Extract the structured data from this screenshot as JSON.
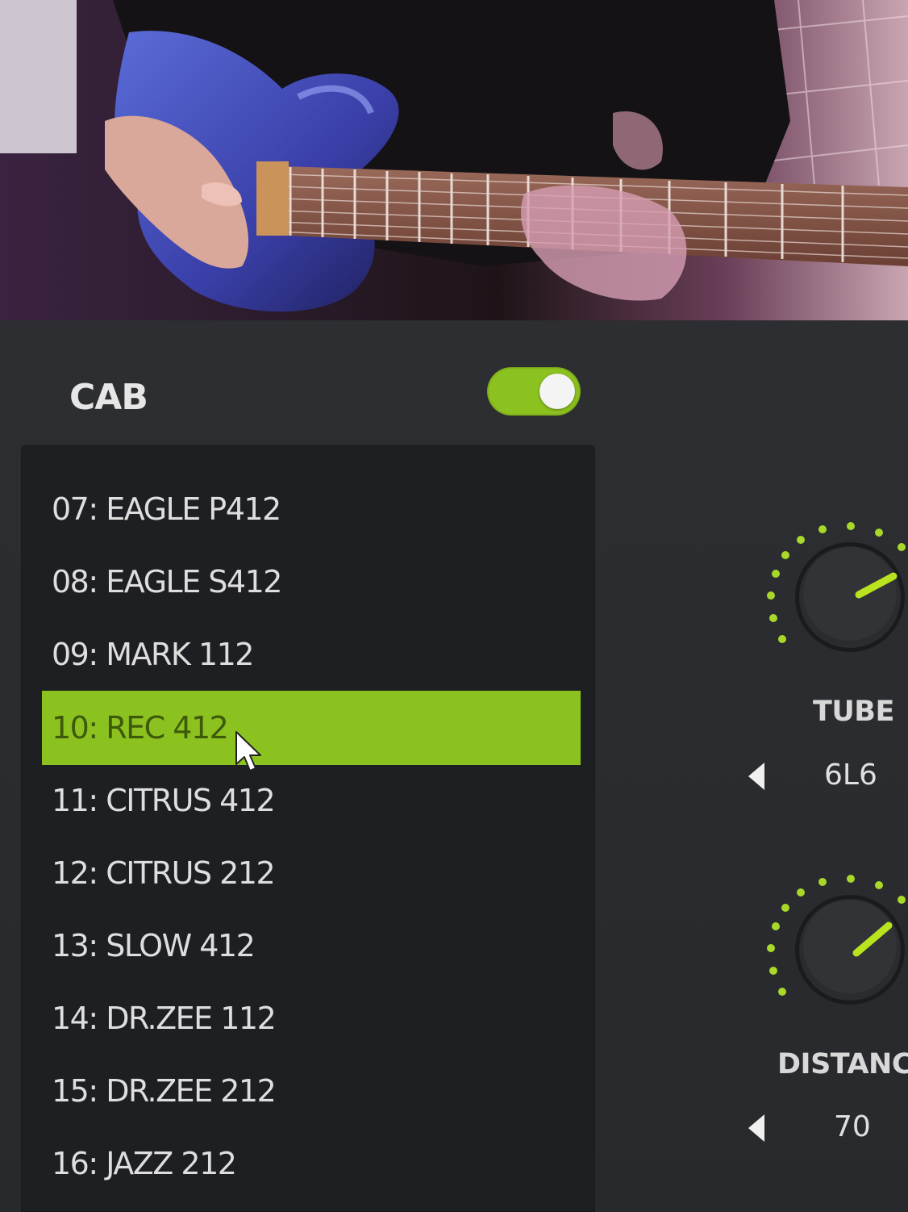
{
  "cab": {
    "title": "CAB",
    "enabled": true,
    "accent_color": "#8cc21f",
    "items": [
      {
        "label": "07: EAGLE P412",
        "selected": false
      },
      {
        "label": "08: EAGLE S412",
        "selected": false
      },
      {
        "label": "09: MARK 112",
        "selected": false
      },
      {
        "label": "10: REC 412",
        "selected": true
      },
      {
        "label": "11: CITRUS 412",
        "selected": false
      },
      {
        "label": "12: CITRUS 212",
        "selected": false
      },
      {
        "label": "13: SLOW 412",
        "selected": false
      },
      {
        "label": "14: DR.ZEE 112",
        "selected": false
      },
      {
        "label": "15: DR.ZEE 212",
        "selected": false
      },
      {
        "label": "16: JAZZ 212",
        "selected": false
      }
    ]
  },
  "controls": {
    "tube": {
      "label": "TUBE",
      "value": "6L6",
      "icon": "triangle-left-icon"
    },
    "distance": {
      "label": "DISTANC",
      "value": "70",
      "icon": "triangle-left-icon"
    }
  }
}
